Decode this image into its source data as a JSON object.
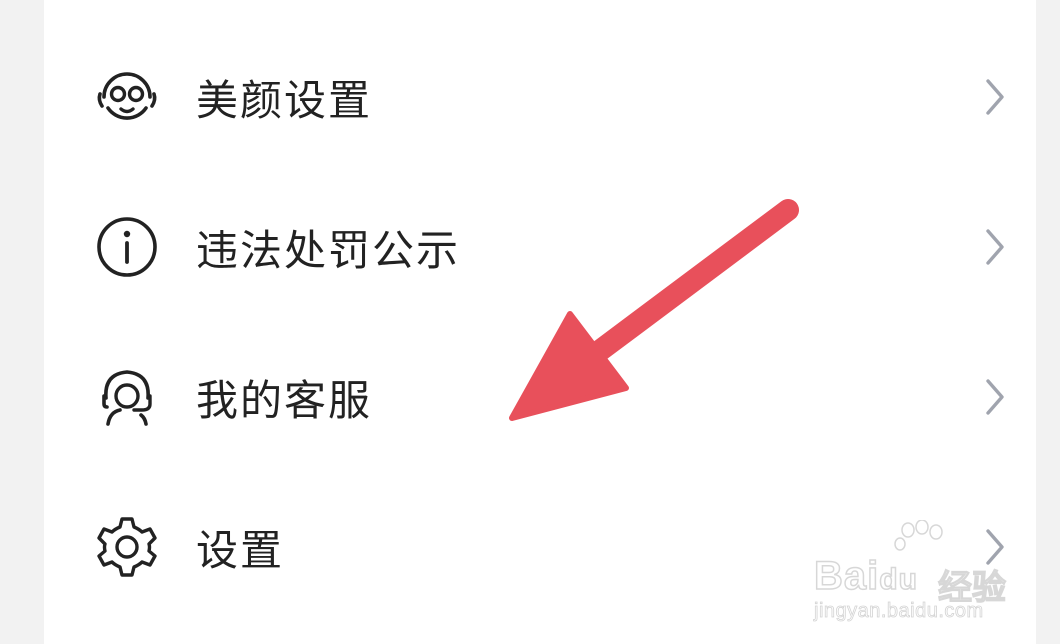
{
  "menu": {
    "items": [
      {
        "label": "美颜设置",
        "icon": "beauty-face-icon"
      },
      {
        "label": "违法处罚公示",
        "icon": "info-icon"
      },
      {
        "label": "我的客服",
        "icon": "customer-service-icon"
      },
      {
        "label": "设置",
        "icon": "gear-icon"
      }
    ],
    "chevron_icon": "chevron-right-icon"
  },
  "annotation": {
    "arrow_color": "#e8505b",
    "points_to": "我的客服"
  },
  "watermark": {
    "brand": "Bai",
    "paw": "du",
    "sub": "经验",
    "url": "jingyan.baidu.com"
  },
  "colors": {
    "background": "#f2f2f2",
    "card": "#ffffff",
    "text": "#222222",
    "chevron": "#a0a4ae",
    "icon": "#222222"
  }
}
